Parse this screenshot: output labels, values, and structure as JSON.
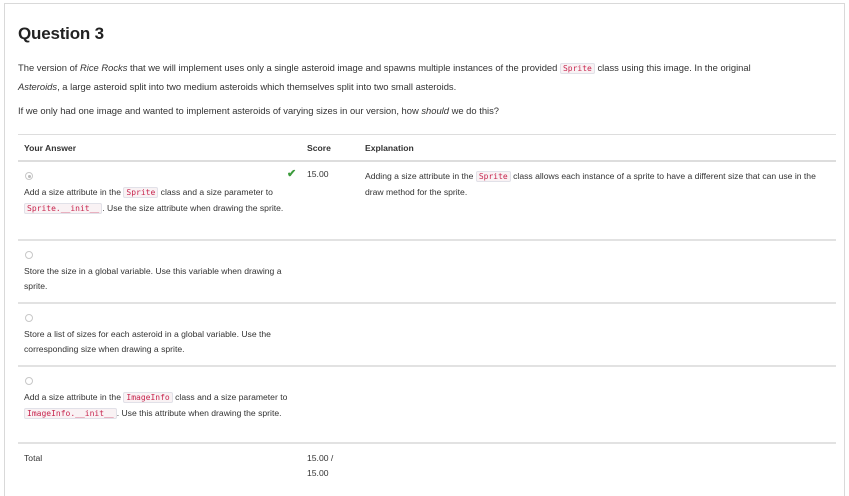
{
  "question": {
    "title": "Question 3",
    "text1_before_game": "The version of ",
    "game_name": "Rice Rocks",
    "text1_mid": " that we will implement uses only a single asteroid image and spawns multiple instances of the provided ",
    "sprite_code": "Sprite",
    "text1_after": " class using this image. In the original",
    "original_game": "Asteroids",
    "text1_end": ", a large asteroid split into two medium asteroids which themselves split into two small asteroids.",
    "text2_before": "If we only had one image and wanted to implement asteroids of varying sizes in our version, how ",
    "text2_em": "should",
    "text2_after": " we do this?"
  },
  "table": {
    "headers": {
      "answer": "Your Answer",
      "score": "Score",
      "explanation": "Explanation"
    },
    "rows": [
      {
        "selected": true,
        "answer_parts": [
          "Add a size attribute in the ",
          "Sprite",
          " class and a size parameter to ",
          "Sprite.__init__",
          ". Use the size attribute when drawing the sprite."
        ],
        "score": "15.00",
        "correct": true,
        "explanation_parts": [
          "Adding a size attribute in the ",
          "Sprite",
          " class allows each instance of a sprite to have a different size that can use in the draw method for the sprite."
        ]
      },
      {
        "selected": false,
        "answer": "Store the size in a global variable. Use this variable when drawing a sprite."
      },
      {
        "selected": false,
        "answer": "Store a list of sizes for each asteroid in a global variable. Use the corresponding size when drawing a sprite."
      },
      {
        "selected": false,
        "answer_parts": [
          "Add a size attribute in the ",
          "ImageInfo",
          " class and a size parameter to ",
          "ImageInfo.__init__",
          ". Use this attribute when drawing the sprite."
        ]
      }
    ],
    "total_label": "Total",
    "total_score": "15.00 /",
    "total_max": "15.00"
  },
  "colors": {
    "check": "#3c9b3c",
    "code_text": "#c7254e",
    "code_bg": "#f9f2f4"
  },
  "icons": {
    "check": "check-icon",
    "radio": "radio-icon"
  }
}
